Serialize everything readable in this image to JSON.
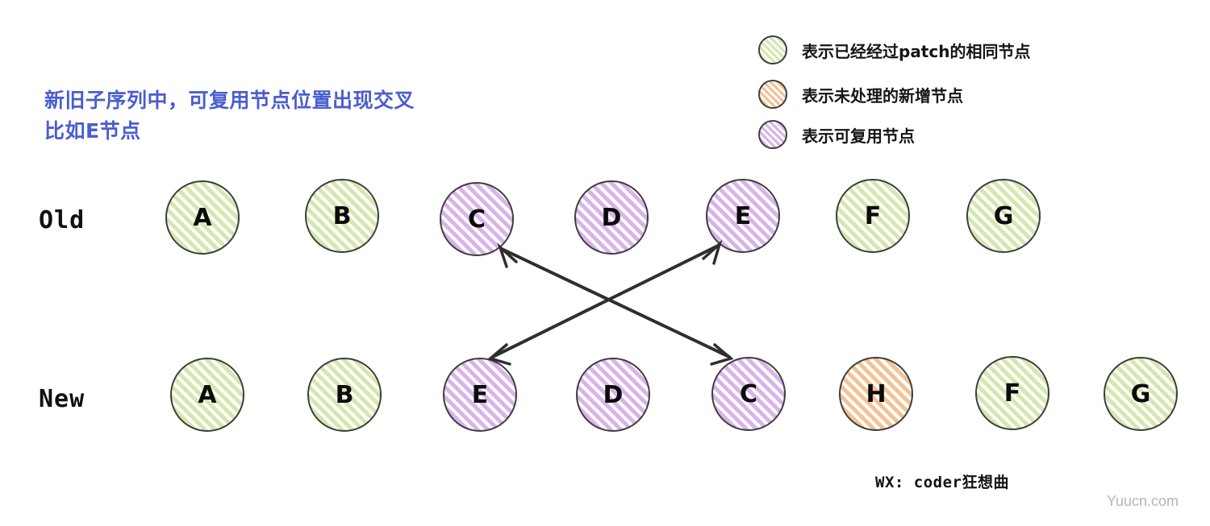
{
  "title": {
    "line1": "新旧子序列中，可复用节点位置出现交叉",
    "line2": "比如E节点",
    "color": "#4a5ed0"
  },
  "legend": {
    "items": [
      {
        "swatch": "green-hatched-circle",
        "label": "表示已经经过patch的相同节点",
        "color": "#d4e8ad"
      },
      {
        "swatch": "orange-hatched-circle",
        "label": "表示未处理的新增节点",
        "color": "#f3c294"
      },
      {
        "swatch": "purple-hatched-circle",
        "label": "表示可复用节点",
        "color": "#d9b3ea"
      }
    ]
  },
  "rows": [
    {
      "label": "Old",
      "nodes": [
        {
          "label": "A",
          "fill": "green"
        },
        {
          "label": "B",
          "fill": "green"
        },
        {
          "label": "C",
          "fill": "purple"
        },
        {
          "label": "D",
          "fill": "purple"
        },
        {
          "label": "E",
          "fill": "purple"
        },
        {
          "label": "F",
          "fill": "green"
        },
        {
          "label": "G",
          "fill": "green"
        }
      ]
    },
    {
      "label": "New",
      "nodes": [
        {
          "label": "A",
          "fill": "green"
        },
        {
          "label": "B",
          "fill": "green"
        },
        {
          "label": "E",
          "fill": "purple"
        },
        {
          "label": "D",
          "fill": "purple"
        },
        {
          "label": "C",
          "fill": "purple"
        },
        {
          "label": "H",
          "fill": "orange"
        },
        {
          "label": "F",
          "fill": "green"
        },
        {
          "label": "G",
          "fill": "green"
        }
      ]
    }
  ],
  "connections": [
    {
      "from": "old-C",
      "to": "new-C",
      "style": "double-headed-arrow"
    },
    {
      "from": "old-E",
      "to": "new-E",
      "style": "double-headed-arrow"
    }
  ],
  "watermarks": {
    "wx": "WX: coder狂想曲",
    "site": "Yuucn.com"
  }
}
